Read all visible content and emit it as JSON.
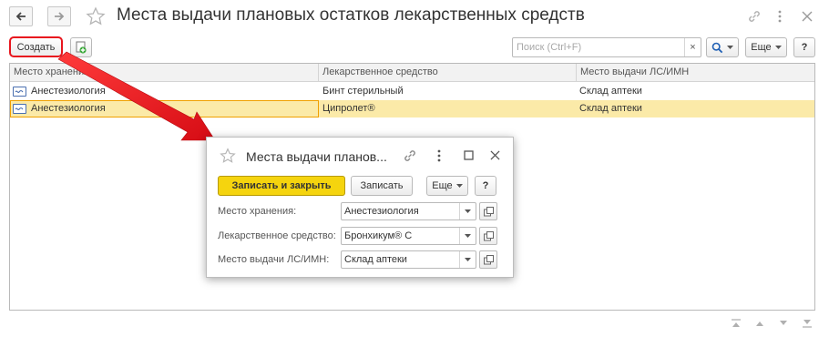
{
  "window": {
    "title": "Места выдачи плановых остатков лекарственных средств",
    "back_icon": "arrow-left-icon",
    "forward_icon": "arrow-right-icon",
    "favorite_icon": "star-icon",
    "link_icon": "link-icon",
    "menu_icon": "more-vertical-icon",
    "close_icon": "close-icon"
  },
  "toolbar": {
    "create_label": "Создать",
    "copy_icon": "add-copy-icon",
    "search_placeholder": "Поиск (Ctrl+F)",
    "search_clear": "×",
    "search_icon": "search-icon",
    "more_label": "Еще",
    "help_label": "?"
  },
  "table": {
    "columns": [
      "Место хранения",
      "Лекарственное средство",
      "Место выдачи ЛС/ИМН"
    ],
    "rows": [
      {
        "storage": "Анестезиология",
        "drug": "Бинт стерильный",
        "issue_place": "Склад аптеки",
        "selected": false
      },
      {
        "storage": "Анестезиология",
        "drug": "Ципролет®",
        "issue_place": "Склад аптеки",
        "selected": true
      }
    ]
  },
  "dialog": {
    "title": "Места выдачи планов...",
    "save_close_label": "Записать и закрыть",
    "save_label": "Записать",
    "more_label": "Еще",
    "help_label": "?",
    "fields": [
      {
        "label": "Место хранения:",
        "value": "Анестезиология"
      },
      {
        "label": "Лекарственное средство:",
        "value": "Бронхикум® С"
      },
      {
        "label": "Место выдачи ЛС/ИМН:",
        "value": "Склад аптеки"
      }
    ]
  },
  "colors": {
    "highlight_row": "#fbeaa8",
    "primary_button": "#f5d40e",
    "annotation_red": "#e8161e"
  }
}
